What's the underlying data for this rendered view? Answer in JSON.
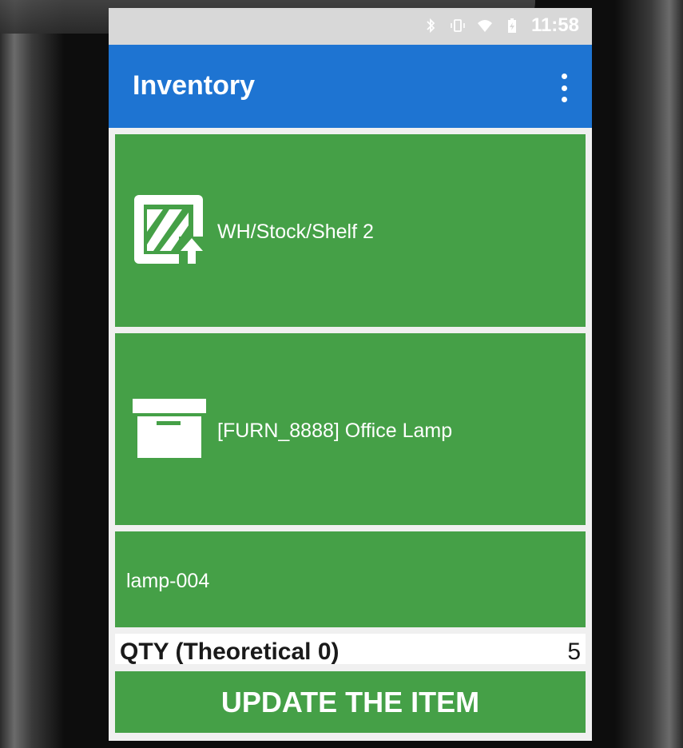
{
  "status_bar": {
    "time": "11:58",
    "icons": [
      "bluetooth-icon",
      "vibrate-icon",
      "wifi-icon",
      "battery-charging-icon"
    ]
  },
  "app_bar": {
    "title": "Inventory",
    "menu_icon": "overflow-menu-icon"
  },
  "location": {
    "icon": "location-shelf-icon",
    "label": "WH/Stock/Shelf 2"
  },
  "product": {
    "icon": "archive-box-icon",
    "label": "[FURN_8888] Office Lamp"
  },
  "lot": {
    "label": "lamp-004"
  },
  "quantity": {
    "label": "QTY (Theoretical 0)",
    "value": "5"
  },
  "actions": {
    "update_label": "UPDATE THE ITEM"
  },
  "colors": {
    "app_bar": "#1e74d2",
    "card_green": "#45a047",
    "background": "#f0f0f0"
  }
}
